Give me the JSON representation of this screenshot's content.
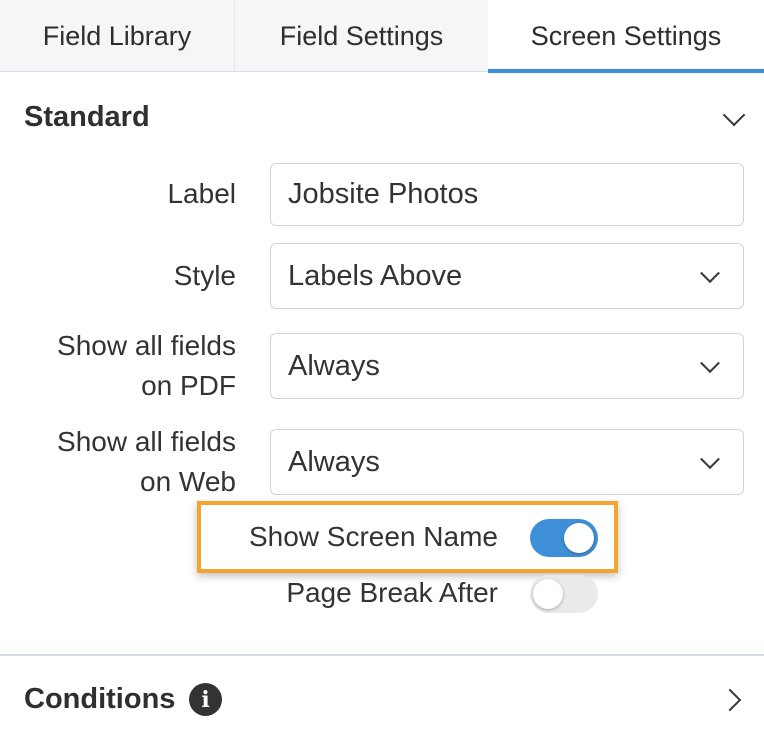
{
  "tabs": [
    {
      "label": "Field Library"
    },
    {
      "label": "Field Settings"
    },
    {
      "label": "Screen Settings",
      "active": true
    }
  ],
  "standard": {
    "title": "Standard",
    "label_field": {
      "label": "Label",
      "value": "Jobsite Photos"
    },
    "style_field": {
      "label": "Style",
      "value": "Labels Above"
    },
    "pdf_field": {
      "label_line1": "Show all fields",
      "label_line2": "on PDF",
      "value": "Always"
    },
    "web_field": {
      "label_line1": "Show all fields",
      "label_line2": "on Web",
      "value": "Always"
    },
    "show_screen_name": {
      "label": "Show Screen Name",
      "on": true
    },
    "page_break_after": {
      "label": "Page Break After",
      "on": false
    }
  },
  "conditions": {
    "title": "Conditions",
    "info_icon": "i"
  },
  "colors": {
    "accent": "#3d8fd9",
    "highlight": "#f2a531",
    "toggle_off": "#e8eaec"
  },
  "icons": {
    "collapse": "chevron-down-icon",
    "dropdown": "chevron-down-icon",
    "expand": "chevron-right-icon",
    "info": "info-icon"
  }
}
